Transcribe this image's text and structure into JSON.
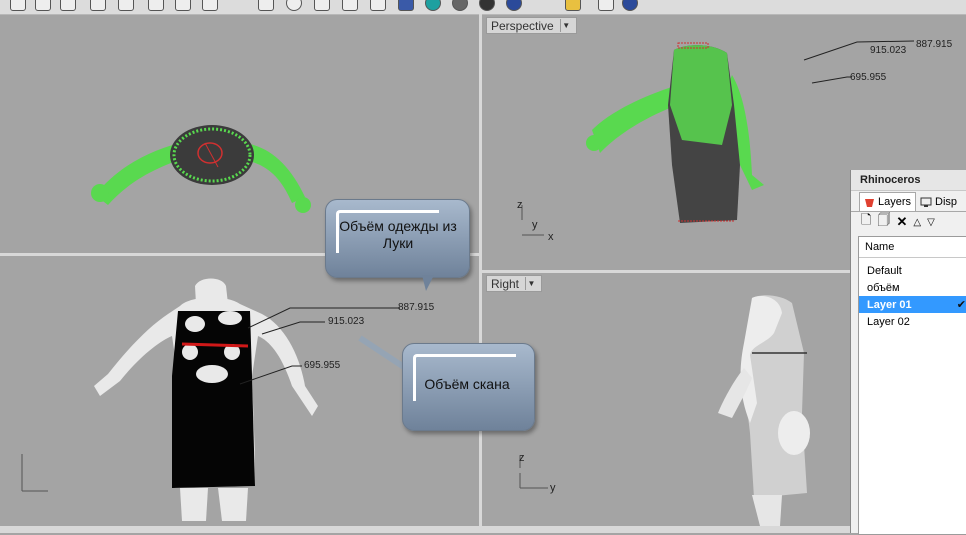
{
  "viewports": {
    "perspective": {
      "label": "Perspective"
    },
    "right": {
      "label": "Right"
    }
  },
  "annotations": {
    "top": {
      "a": "887.915",
      "b": "915.023",
      "c": "695.955"
    },
    "front": {
      "a": "887.915",
      "b": "915.023",
      "c": "695.955"
    }
  },
  "callouts": {
    "garment": "Объём одежды из Луки",
    "scan": "Объём скана"
  },
  "axes": {
    "x": "x",
    "y": "y",
    "z": "z"
  },
  "panel": {
    "title": "Rhinoceros",
    "tabs": [
      "Layers",
      "Disp"
    ],
    "column_name": "Name",
    "layers": [
      "Default",
      "объём",
      "Layer 01",
      "Layer 02"
    ],
    "selected_layer_check": "✔"
  },
  "colors": {
    "scan_green": "#59d94f",
    "viewport_bg": "#a4a4a4",
    "selection": "#3399ff"
  }
}
